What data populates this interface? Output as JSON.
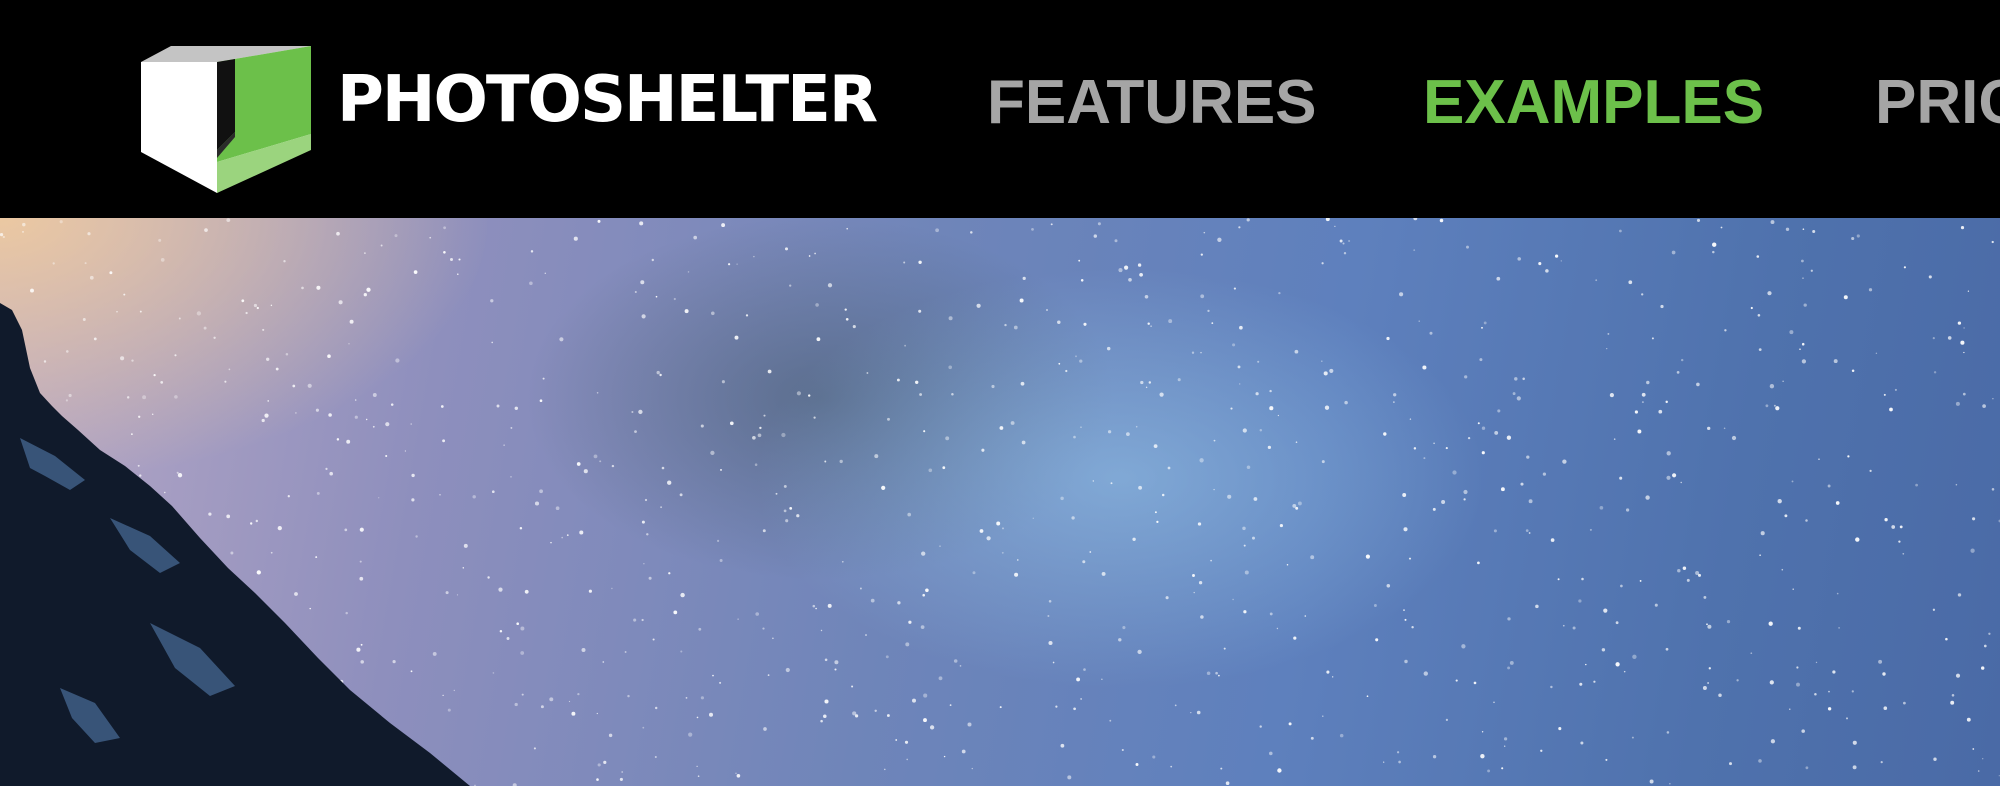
{
  "brand": {
    "name": "PHOTOSHELTER",
    "logo_icon": "open-box-icon",
    "colors": {
      "green": "#6cc04a",
      "light_green": "#9bd47e",
      "grey": "#c4c4c4",
      "white": "#ffffff"
    }
  },
  "nav": {
    "items": [
      {
        "label": "FEATURES",
        "active": false
      },
      {
        "label": "EXAMPLES",
        "active": true
      },
      {
        "label": "PRICING",
        "active": false
      }
    ],
    "colors": {
      "default": "#a5a5a5",
      "active": "#6cc04a",
      "background": "#000000"
    }
  },
  "hero": {
    "image": "night-sky-milky-way-over-mountain"
  }
}
